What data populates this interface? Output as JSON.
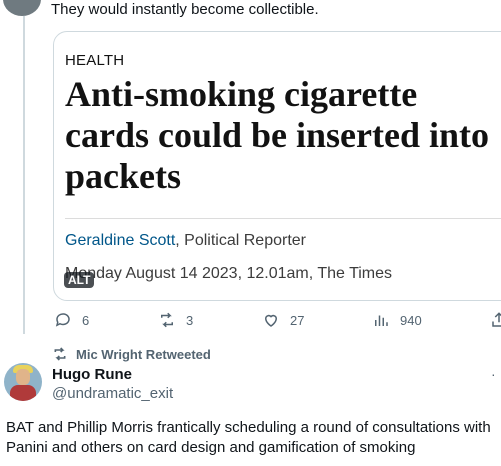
{
  "previous_tweet": {
    "text": "They would instantly become collectible."
  },
  "link_card": {
    "section": "HEALTH",
    "headline": "Anti-smoking cigarette cards could be inserted into packets",
    "author": "Geraldine Scott",
    "author_suffix": ", Political Reporter",
    "date": "Monday August 14 2023, 12.01am, The Times",
    "alt_badge": "ALT"
  },
  "actions": {
    "replies": "6",
    "retweets": "3",
    "likes": "27",
    "views": "940"
  },
  "retweet_context": {
    "text": "Mic Wright Retweeted"
  },
  "tweet": {
    "name": "Hugo Rune",
    "handle": "@undramatic_exit",
    "text": "BAT and Phillip Morris frantically scheduling a round of consultations with Panini and others on card design and gamification of smoking"
  },
  "colors": {
    "text": "#0f1419",
    "secondary": "#536471",
    "border": "#cfd9de",
    "author_link": "#005689"
  },
  "icons": [
    "reply-icon",
    "retweet-icon",
    "like-icon",
    "views-icon",
    "share-icon",
    "more-icon"
  ]
}
